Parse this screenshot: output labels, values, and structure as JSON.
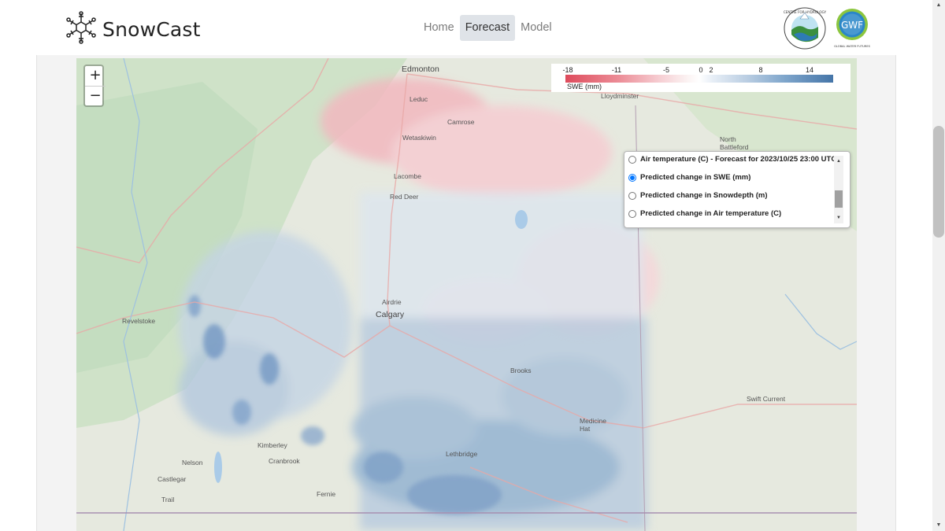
{
  "app": {
    "title": "SnowCast"
  },
  "nav": {
    "items": [
      "Home",
      "Forecast",
      "Model"
    ],
    "active": "Forecast"
  },
  "logos": {
    "left": {
      "name": "Centre for Hydrology logo",
      "text": "CENTRE FOR HYDROLOGY"
    },
    "right": {
      "name": "Global Water Futures logo",
      "text": "GWF",
      "subtext": "GLOBAL WATER FUTURES"
    }
  },
  "map": {
    "zoom": {
      "in_label": "+",
      "out_label": "−"
    },
    "legend": {
      "ticks": [
        "-18",
        "-11",
        "-5",
        "0",
        "2",
        "8",
        "14"
      ],
      "title": "SWE (mm)",
      "colors": {
        "negative": "#de4b5c",
        "neutral": "#ffffff",
        "positive": "#4575a8"
      }
    },
    "layers": [
      {
        "label": "Air temperature (C) - Forecast for 2023/10/25 23:00 UTC",
        "checked": false
      },
      {
        "label": "Predicted change in SWE (mm)",
        "checked": true
      },
      {
        "label": "Predicted change in Snowdepth (m)",
        "checked": false
      },
      {
        "label": "Predicted change in Air temperature (C)",
        "checked": false
      }
    ],
    "places": {
      "edmonton": "Edmonton",
      "leduc": "Leduc",
      "lloydminster": "Lloydminster",
      "camrose": "Camrose",
      "wetaskiwin": "Wetaskiwin",
      "north_battleford": "North\nBattleford",
      "lacombe": "Lacombe",
      "red_deer": "Red Deer",
      "airdrie": "Airdrie",
      "calgary": "Calgary",
      "revelstoke": "Revelstoke",
      "brooks": "Brooks",
      "swift_current": "Swift Current",
      "medicine_hat": "Medicine\nHat",
      "kimberley": "Kimberley",
      "cranbrook": "Cranbrook",
      "lethbridge": "Lethbridge",
      "nelson": "Nelson",
      "castlegar": "Castlegar",
      "fernie": "Fernie",
      "trail": "Trail"
    }
  }
}
